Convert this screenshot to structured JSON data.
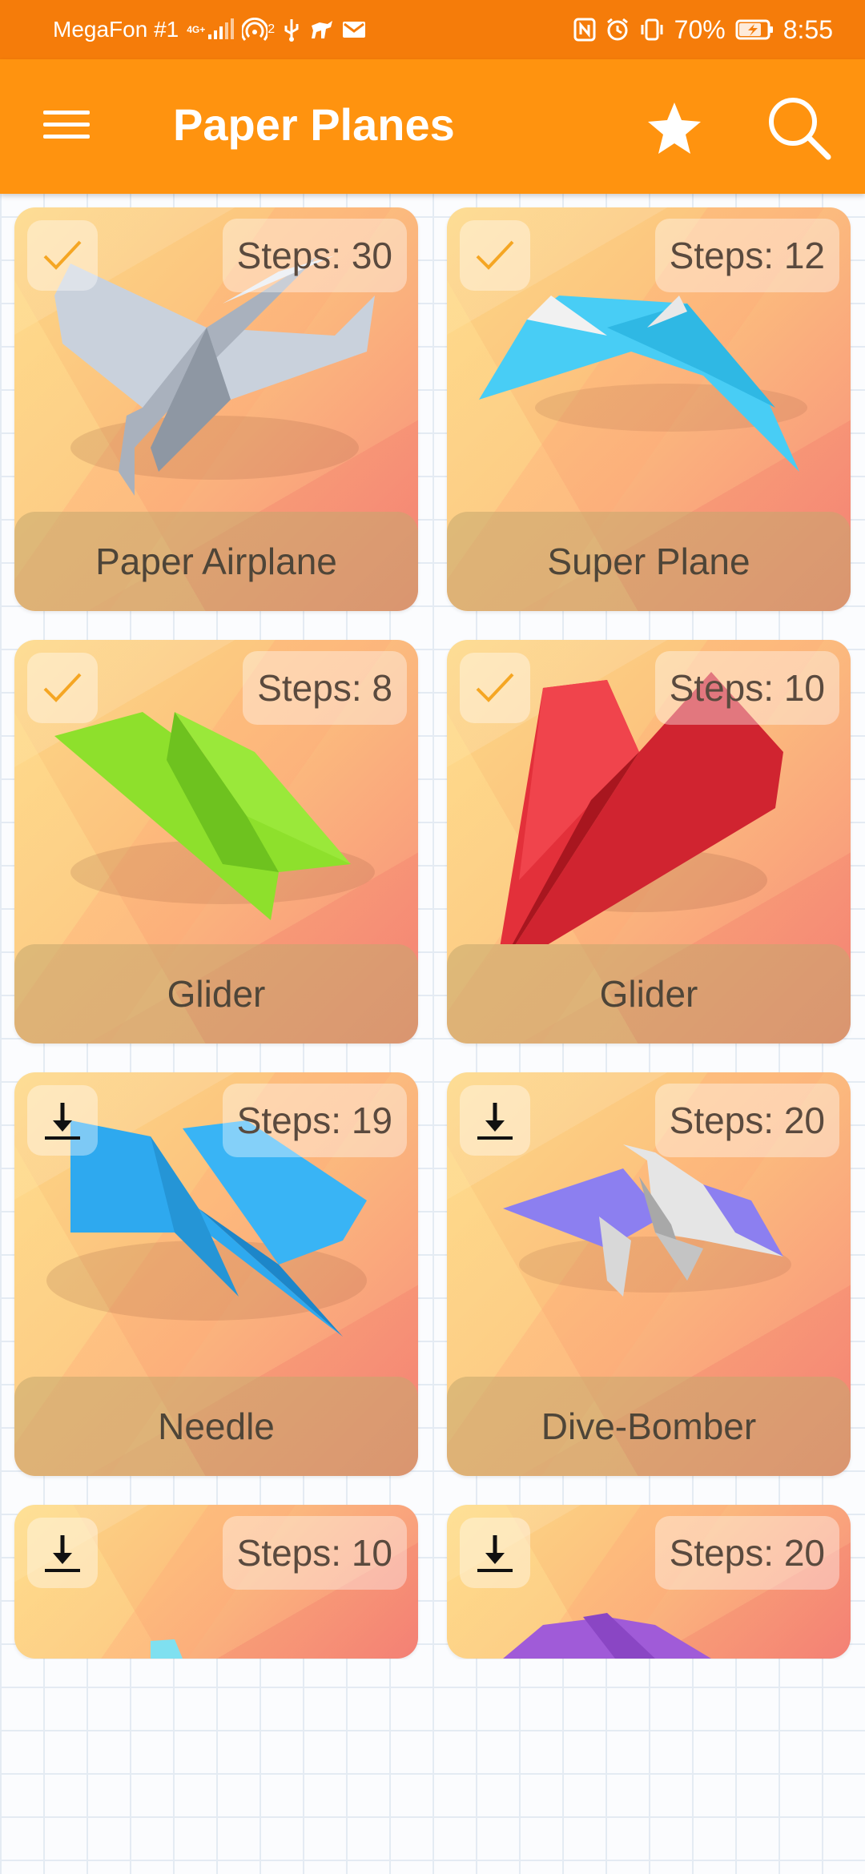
{
  "status_bar": {
    "carrier": "MegaFon #1",
    "network": "4G+",
    "hotspot_count": "2",
    "battery": "70%",
    "time": "8:55"
  },
  "app_bar": {
    "title": "Paper Planes",
    "menu_icon": "hamburger-menu-icon",
    "favorite_icon": "star-icon",
    "search_icon": "search-icon"
  },
  "colors": {
    "status_bar": "#f57c0a",
    "app_bar": "#ff930f",
    "card_gradient_start": "#fdd886",
    "card_gradient_end": "#f5867a",
    "check_color": "#f5a623"
  },
  "planes": [
    {
      "name": "Paper Airplane",
      "steps": "Steps: 30",
      "status": "completed",
      "status_icon": "checkmark-icon",
      "plane_color": "#c8d0dc"
    },
    {
      "name": "Super Plane",
      "steps": "Steps: 12",
      "status": "completed",
      "status_icon": "checkmark-icon",
      "plane_color": "#4fcff5"
    },
    {
      "name": "Glider",
      "steps": "Steps: 8",
      "status": "completed",
      "status_icon": "checkmark-icon",
      "plane_color": "#8ee02c"
    },
    {
      "name": "Glider",
      "steps": "Steps: 10",
      "status": "completed",
      "status_icon": "checkmark-icon",
      "plane_color": "#e02b34"
    },
    {
      "name": "Needle",
      "steps": "Steps: 19",
      "status": "download",
      "status_icon": "download-icon",
      "plane_color": "#2ea9ef"
    },
    {
      "name": "Dive-Bomber",
      "steps": "Steps: 20",
      "status": "download",
      "status_icon": "download-icon",
      "plane_color": "#8c7ff0"
    },
    {
      "steps": "Steps: 10",
      "status": "download",
      "status_icon": "download-icon",
      "plane_color": "#7fe0f0"
    },
    {
      "steps": "Steps: 20",
      "status": "download",
      "status_icon": "download-icon",
      "plane_color": "#a05bd8"
    }
  ]
}
